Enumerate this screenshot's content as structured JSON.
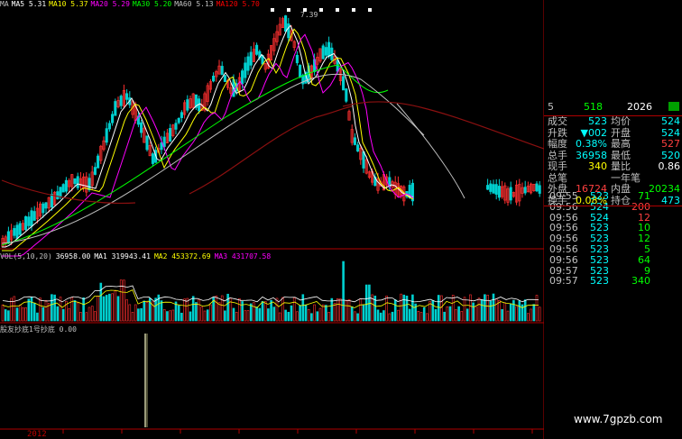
{
  "ma_legend": [
    {
      "label": "MA",
      "color": "#c0c0c0"
    },
    {
      "label": "MA5 5.31",
      "color": "#ffffff"
    },
    {
      "label": "MA10 5.37",
      "color": "#ffff00"
    },
    {
      "label": "MA20 5.29",
      "color": "#ff00ff"
    },
    {
      "label": "MA30 5.20",
      "color": "#00ff00"
    },
    {
      "label": "MA60 5.13",
      "color": "#c0c0c0"
    },
    {
      "label": "MA120 5.70",
      "color": "#ff0000"
    }
  ],
  "peak_label": "7.39",
  "vol_legend": [
    {
      "label": "VOL(5,10,20)",
      "color": "#c0c0c0"
    },
    {
      "label": "36958.00",
      "color": "#ffffff"
    },
    {
      "label": "MA1 319943.41",
      "color": "#ffffff"
    },
    {
      "label": "MA2 453372.69",
      "color": "#ffff00"
    },
    {
      "label": "MA3 431707.58",
      "color": "#ff00ff"
    }
  ],
  "indicator_legend": "股友抄底1号抄底 0.00",
  "year_label": "2012",
  "panel": {
    "header": {
      "col1": "5",
      "col2": "518",
      "col3": "2026"
    },
    "quote_rows": [
      {
        "l1": "成交",
        "v1": "523",
        "l2": "均价",
        "v2": "524",
        "c1": "#00ffff",
        "c2": "#00ffff"
      },
      {
        "l1": "升跌",
        "v1": "▼002",
        "l2": "开盘",
        "v2": "524",
        "c1": "#00ffff",
        "c2": "#00ffff"
      },
      {
        "l1": "幅度",
        "v1": "0.38%",
        "l2": "最高",
        "v2": "527",
        "c1": "#00ffff",
        "c2": "#ff4040"
      },
      {
        "l1": "总手",
        "v1": "36958",
        "l2": "最低",
        "v2": "520",
        "c1": "#00ffff",
        "c2": "#00ffff"
      },
      {
        "l1": "现手",
        "v1": "340",
        "l2": "量比",
        "v2": "0.86",
        "c1": "#ffff00",
        "c2": "#ffffff"
      },
      {
        "l1": "总笔",
        "v1": "",
        "l2": "一年笔",
        "v2": "",
        "c1": "#ffff00",
        "c2": "#ffffff"
      },
      {
        "l1": "外盘",
        "v1": "16724",
        "l2": "内盘",
        "v2": "20234",
        "c1": "#ff4040",
        "c2": "#00ff00"
      },
      {
        "l1": "换手",
        "v1": "0.08%",
        "l2": "持仓",
        "v2": "473",
        "c1": "#ffff00",
        "c2": "#00ffff"
      }
    ],
    "ticks": [
      {
        "time": "09:55",
        "price": "523",
        "vol": "71",
        "vc": "#00ff00"
      },
      {
        "time": "09:56",
        "price": "524",
        "vol": "200",
        "vc": "#ff4040"
      },
      {
        "time": "09:56",
        "price": "524",
        "vol": "12",
        "vc": "#ff4040"
      },
      {
        "time": "09:56",
        "price": "523",
        "vol": "10",
        "vc": "#00ff00"
      },
      {
        "time": "09:56",
        "price": "523",
        "vol": "12",
        "vc": "#00ff00"
      },
      {
        "time": "09:56",
        "price": "523",
        "vol": "5",
        "vc": "#00ff00"
      },
      {
        "time": "09:56",
        "price": "523",
        "vol": "64",
        "vc": "#00ff00"
      },
      {
        "time": "09:57",
        "price": "523",
        "vol": "9",
        "vc": "#00ff00"
      },
      {
        "time": "09:57",
        "price": "523",
        "vol": "340",
        "vc": "#00ff00"
      }
    ]
  },
  "watermark": "www.7gpzb.com",
  "colors": {
    "up": "#ff3030",
    "down": "#00d0d0",
    "ma5": "#ffffff",
    "ma10": "#ffff00",
    "ma20": "#ff00ff",
    "ma30": "#00ff00",
    "ma60": "#c0c0c0",
    "ma120": "#c00000"
  }
}
